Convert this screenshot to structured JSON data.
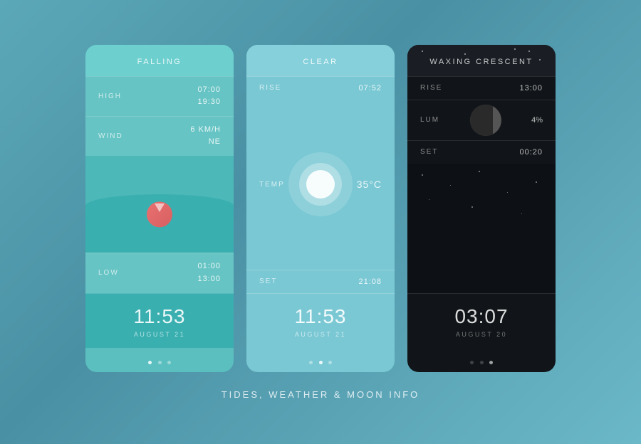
{
  "page": {
    "title": "TIDES, WEATHER & MOON INFO",
    "background": "#5ba8b8"
  },
  "tides_card": {
    "header": "FALLING",
    "high_label": "HIGH",
    "high_time": "07:00",
    "high_value": "19:30",
    "wind_label": "WIND",
    "wind_speed": "6 KM/H",
    "wind_dir": "NE",
    "low_label": "LOW",
    "low_time": "01:00",
    "low_value": "13:00",
    "time": "11:53",
    "date": "AUGUST 21"
  },
  "weather_card": {
    "header": "CLEAR",
    "rise_label": "RISE",
    "rise_value": "07:52",
    "temp_label": "TEMP",
    "temp_value": "35°C",
    "set_label": "SET",
    "set_value": "21:08",
    "time": "11:53",
    "date": "AUGUST 21"
  },
  "moon_card": {
    "header": "WAXING CRESCENT",
    "rise_label": "RISE",
    "rise_value": "13:00",
    "lum_label": "LUM",
    "lum_value": "4%",
    "set_label": "SET",
    "set_value": "00:20",
    "time": "03:07",
    "date": "AUGUST 20"
  }
}
